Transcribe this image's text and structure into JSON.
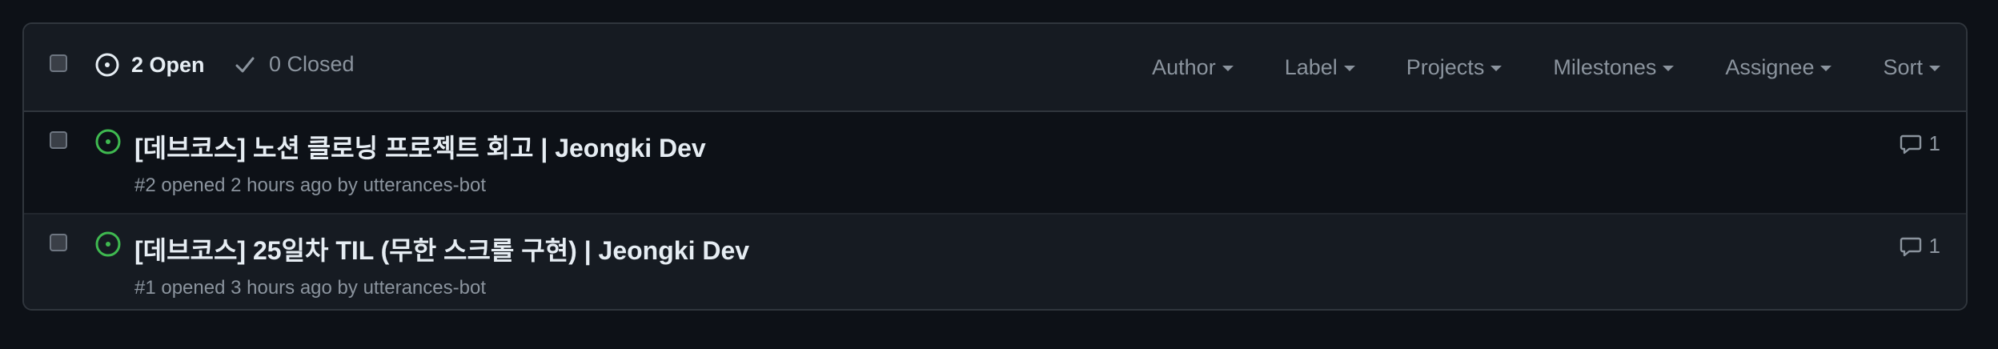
{
  "header": {
    "open_label": "2 Open",
    "closed_label": "0 Closed",
    "filters": [
      "Author",
      "Label",
      "Projects",
      "Milestones",
      "Assignee",
      "Sort"
    ]
  },
  "issues": [
    {
      "title": "[데브코스] 노션 클로닝 프로젝트 회고 | Jeongki Dev",
      "meta": "#2 opened 2 hours ago by utterances-bot",
      "comments": "1",
      "status_color": "#3fb950"
    },
    {
      "title": "[데브코스] 25일차 TIL (무한 스크롤 구현) | Jeongki Dev",
      "meta": "#1 opened 3 hours ago by utterances-bot",
      "comments": "1",
      "status_color": "#3fb950"
    }
  ],
  "icons": {
    "open": "issue-open-icon",
    "closed": "check-icon",
    "comment": "comment-icon"
  }
}
